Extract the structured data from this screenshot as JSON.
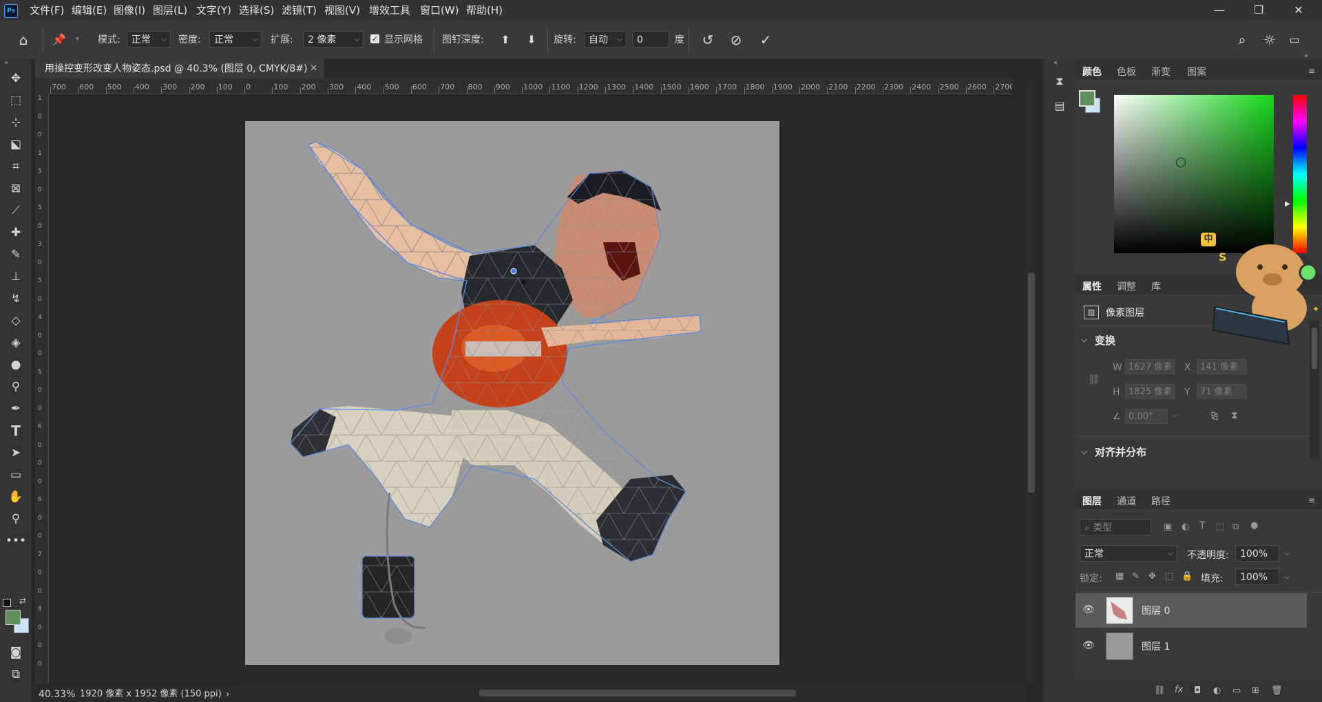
{
  "app": {
    "logo": "Ps",
    "menu": [
      "文件(F)",
      "编辑(E)",
      "图像(I)",
      "图层(L)",
      "文字(Y)",
      "选择(S)",
      "滤镜(T)",
      "视图(V)",
      "增效工具",
      "窗口(W)",
      "帮助(H)"
    ]
  },
  "options": {
    "mode_label": "模式:",
    "mode_value": "正常",
    "density_label": "密度:",
    "density_value": "正常",
    "expand_label": "扩展:",
    "expand_value": "2 像素",
    "show_mesh_label": "显示网格",
    "show_mesh_checked": true,
    "pin_depth_label": "图钉深度:",
    "rotate_label": "旋转:",
    "rotate_value": "自动",
    "angle_value": "0",
    "angle_unit": "度"
  },
  "document": {
    "tab_title": "用操控变形改变人物姿态.psd @ 40.3% (图层 0, CMYK/8#)",
    "close_glyph": "✕"
  },
  "ruler_h": [
    "700",
    "600",
    "500",
    "400",
    "300",
    "200",
    "100",
    "0",
    "100",
    "200",
    "300",
    "400",
    "500",
    "600",
    "700",
    "800",
    "900",
    "1000",
    "1100",
    "1200",
    "1300",
    "1400",
    "1500",
    "1600",
    "1700",
    "1800",
    "1900",
    "2000",
    "2100",
    "2200",
    "2300",
    "2400",
    "2500",
    "2600",
    "2700"
  ],
  "ruler_v": [
    "1",
    "0",
    "0",
    "1",
    "5",
    "0",
    "5",
    "0",
    "3",
    "0",
    "5",
    "0",
    "4",
    "0",
    "0",
    "5",
    "0",
    "0",
    "6",
    "0",
    "0",
    "0",
    "6",
    "0",
    "0",
    "7",
    "0",
    "0",
    "8",
    "0",
    "0",
    "0"
  ],
  "status": {
    "zoom": "40.33%",
    "doc_info": "1920 像素 x 1952 像素 (150 ppi)",
    "arrow": "›"
  },
  "color_panel": {
    "tabs": [
      "颜色",
      "色板",
      "渐变",
      "图案"
    ],
    "active_tab": "颜色",
    "foreground": "#5e8f5c",
    "background": "#cde4f5",
    "hue_color": "#15d81a"
  },
  "properties_panel": {
    "tabs": [
      "属性",
      "调整",
      "库"
    ],
    "active_tab": "属性",
    "layer_type": "像素图层",
    "transform_title": "变换",
    "w_label": "W",
    "w_value": "1627 像素",
    "x_label": "X",
    "x_value": "141 像素",
    "h_label": "H",
    "h_value": "1825 像素",
    "y_label": "Y",
    "y_value": "71 像素",
    "angle_value": "0.00°",
    "align_title": "对齐并分布"
  },
  "layers_panel": {
    "tabs": [
      "图层",
      "通道",
      "路径"
    ],
    "active_tab": "图层",
    "filter_placeholder": "类型",
    "blend_mode": "正常",
    "opacity_label": "不透明度:",
    "opacity_value": "100%",
    "lock_label": "锁定:",
    "fill_label": "填充:",
    "fill_value": "100%",
    "layers": [
      {
        "name": "图层 0",
        "selected": true,
        "visible": true
      },
      {
        "name": "图层 1",
        "selected": false,
        "visible": true
      }
    ]
  },
  "sticker": {
    "badge_text": "中",
    "s_text": "S"
  }
}
